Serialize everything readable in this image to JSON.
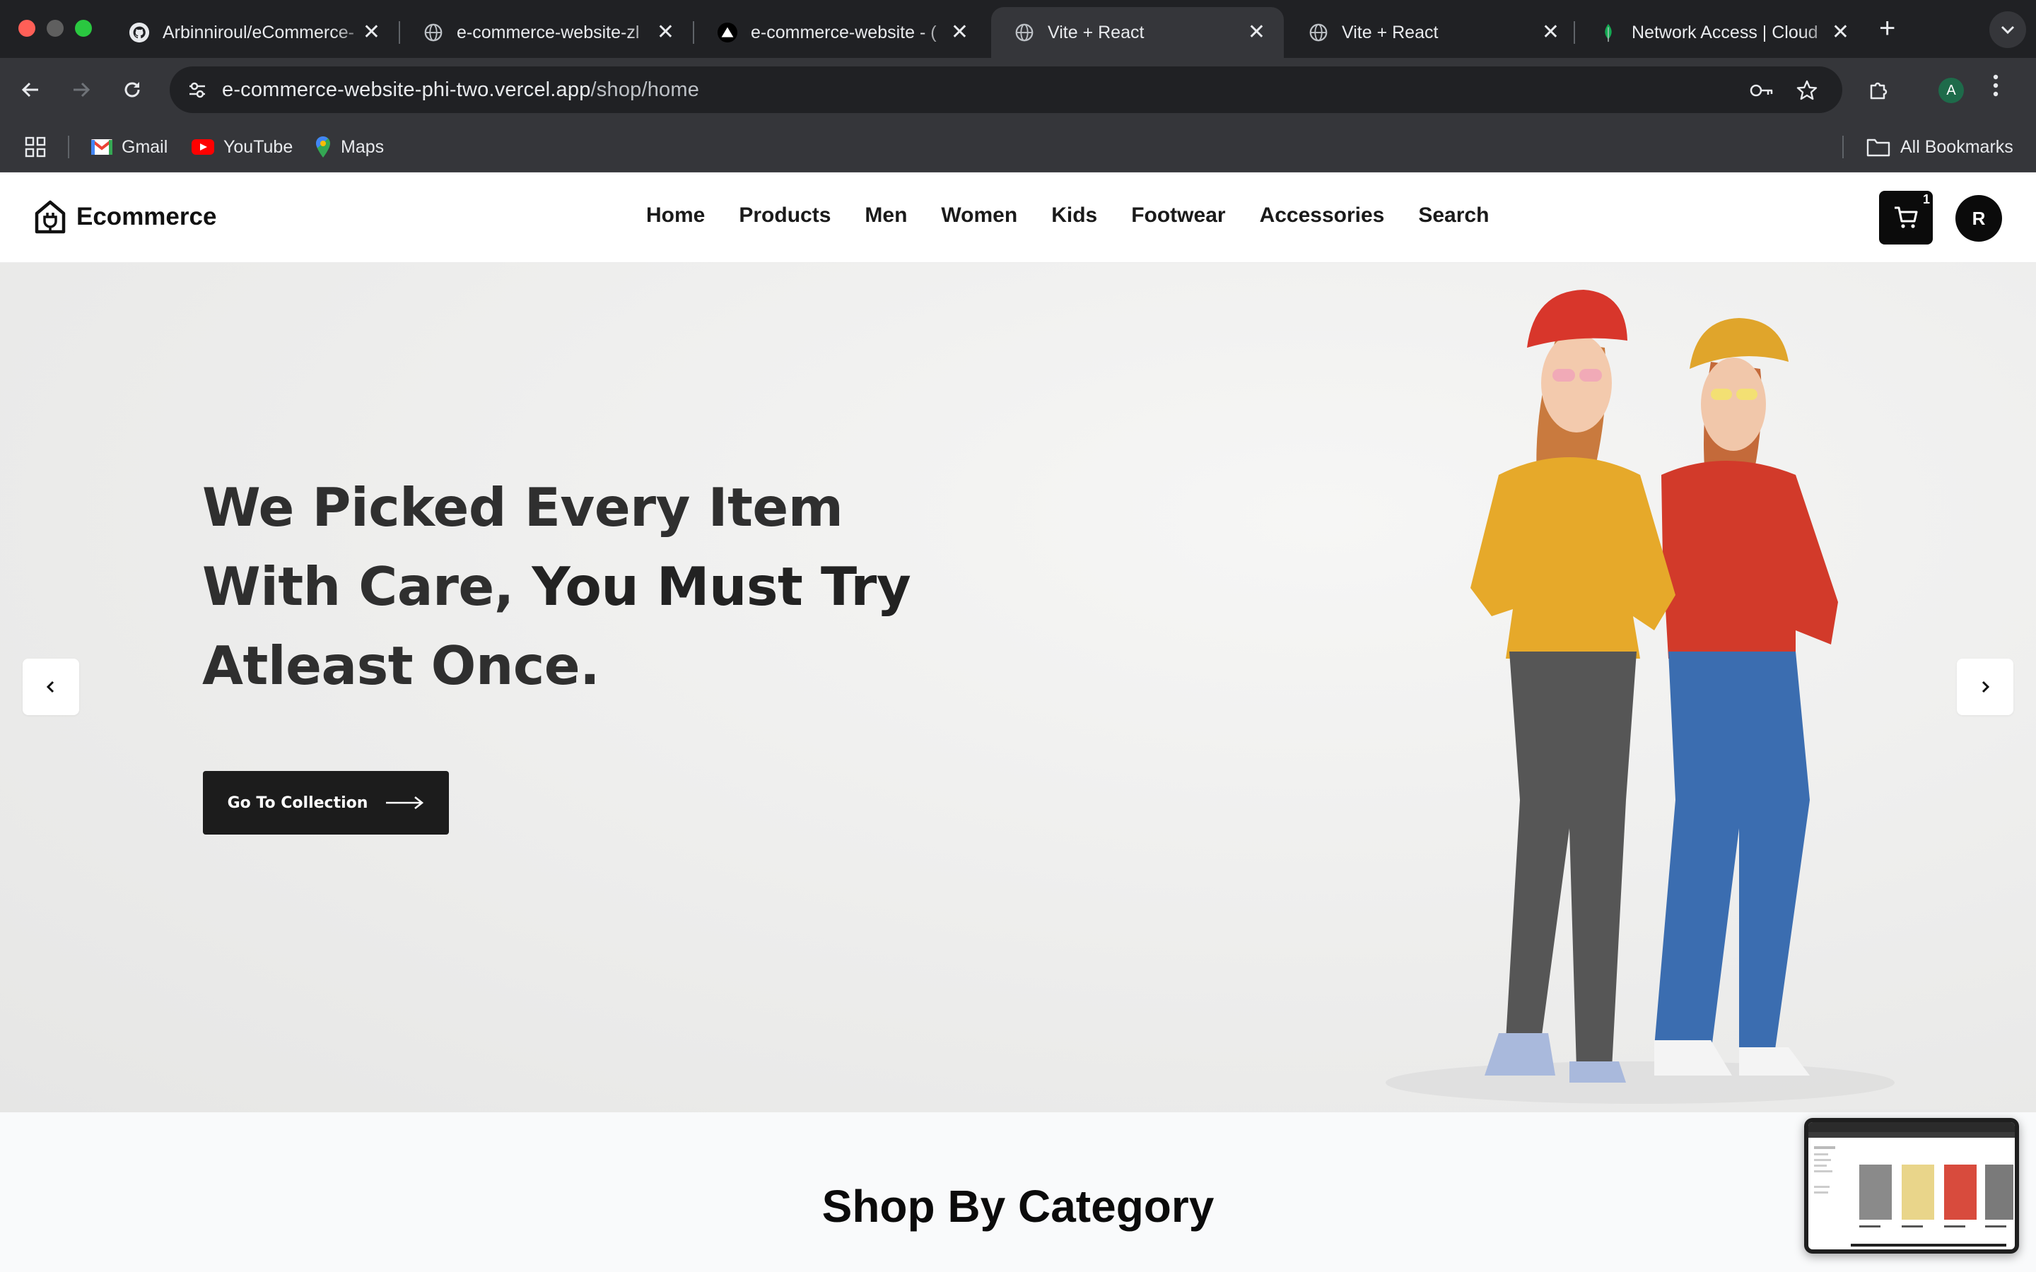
{
  "browser": {
    "tabs": [
      {
        "title": "Arbinniroul/eCommerce-",
        "favicon": "github-icon",
        "active": false
      },
      {
        "title": "e-commerce-website-zl",
        "favicon": "globe-icon",
        "active": false
      },
      {
        "title": "e-commerce-website - (",
        "favicon": "vercel-icon",
        "active": false
      },
      {
        "title": "Vite + React",
        "favicon": "globe-icon",
        "active": true
      },
      {
        "title": "Vite + React",
        "favicon": "globe-icon",
        "active": false
      },
      {
        "title": "Network Access | Cloud",
        "favicon": "mongodb-leaf-icon",
        "active": false
      }
    ],
    "tab_close_glyph": "✕",
    "new_tab_glyph": "+",
    "url_host": "e-commerce-website-phi-two.vercel.app",
    "url_path": "/shop/home",
    "profile_initial": "A",
    "bookmarks": [
      {
        "label": "Gmail",
        "icon": "gmail-icon"
      },
      {
        "label": "YouTube",
        "icon": "youtube-icon"
      },
      {
        "label": "Maps",
        "icon": "maps-pin-icon"
      }
    ],
    "all_bookmarks_label": "All Bookmarks"
  },
  "site": {
    "brand": "Ecommerce",
    "nav": [
      "Home",
      "Products",
      "Men",
      "Women",
      "Kids",
      "Footwear",
      "Accessories",
      "Search"
    ],
    "cart_count": "1",
    "user_initial": "R"
  },
  "hero": {
    "line1": "We Picked Every Item",
    "line2_regular": "With Care, ",
    "line2_bold": "You Must Try",
    "line3": "Atleast Once.",
    "cta_label": "Go To Collection",
    "sweater_left_color": "#e6a92a",
    "sweater_right_color": "#d23a2a",
    "hat_left_color": "#d8362b",
    "hat_right_color": "#e0a52b"
  },
  "category": {
    "title": "Shop By Category"
  },
  "colors": {
    "chrome_dark": "#202124",
    "chrome_toolbar": "#35363a",
    "brand_black": "#0b0b0b"
  }
}
